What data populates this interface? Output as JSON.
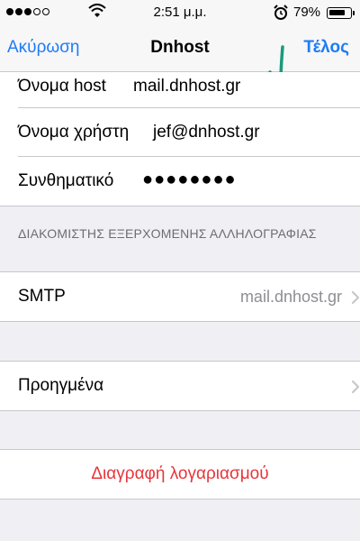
{
  "status_bar": {
    "time": "2:51 μ.μ.",
    "battery": "79%",
    "battery_level": 0.79
  },
  "nav": {
    "cancel": "Ακύρωση",
    "title": "Dnhost",
    "done": "Τέλος"
  },
  "account": {
    "host_label": "Όνομα host",
    "host_value": "mail.dnhost.gr",
    "user_label": "Όνομα χρήστη",
    "user_value": "jef@dnhost.gr",
    "password_label": "Συνθηματικό",
    "password_value": "●●●●●●●●"
  },
  "outgoing": {
    "header": "ΔΙΑΚΟΜΙΣΤΗΣ ΕΞΕΡΧΟΜΕΝΗΣ ΑΛΛΗΛΟΓΡΑΦΙΑΣ",
    "smtp_label": "SMTP",
    "smtp_value": "mail.dnhost.gr"
  },
  "advanced": {
    "label": "Προηγμένα"
  },
  "delete_account": {
    "label": "Διαγραφή λογαριασμού"
  },
  "colors": {
    "accent": "#1e7cf5",
    "destructive": "#e8353a",
    "annotation": "#1a9a7a"
  }
}
